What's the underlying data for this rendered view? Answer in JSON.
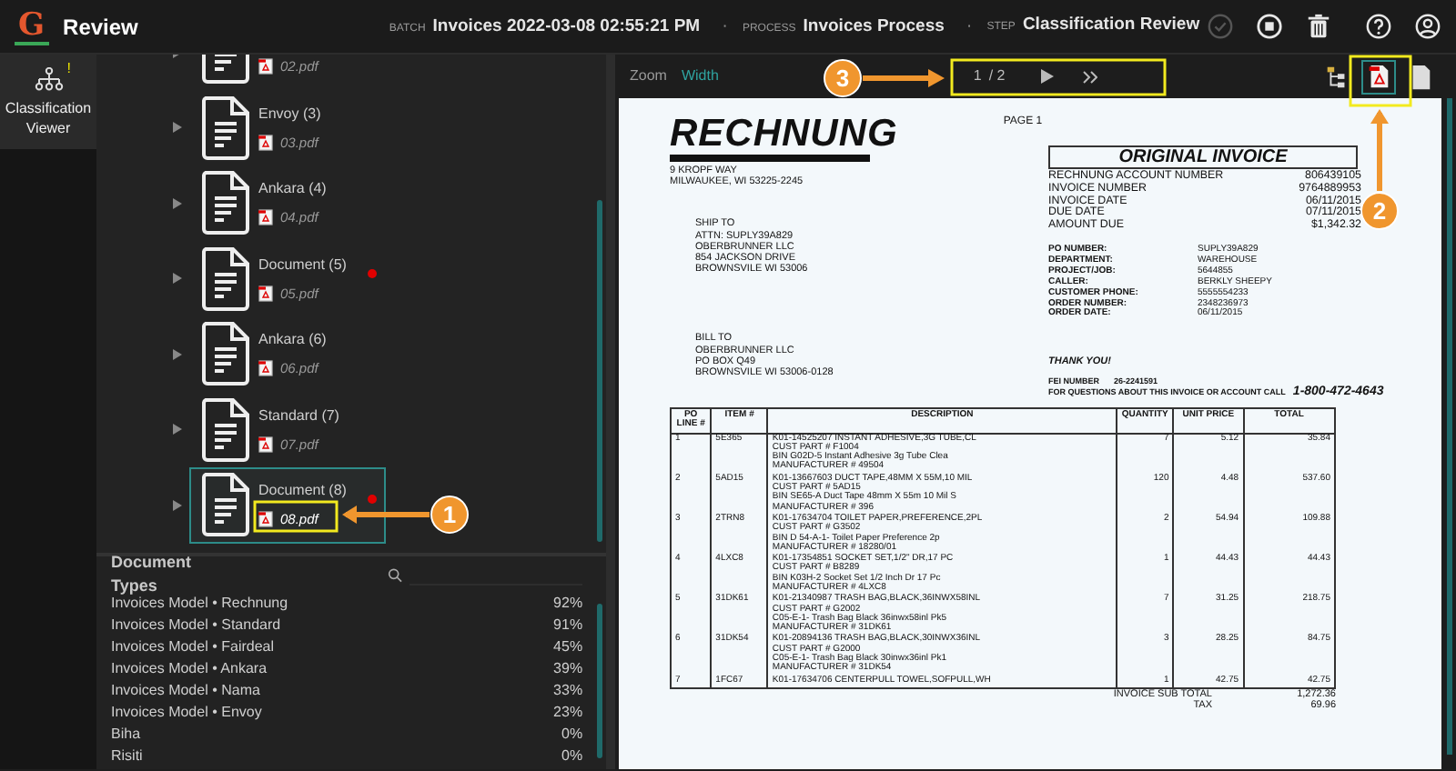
{
  "app": {
    "logo": "G",
    "title": "Review",
    "batch_label": "BATCH",
    "batch": "Invoices 2022-03-08 02:55:21 PM",
    "process_label": "PROCESS",
    "process": "Invoices Process",
    "step_label": "STEP",
    "step": "Classification Review",
    "separators": [
      "·",
      "·"
    ],
    "actions": [
      {
        "kind": "confirm",
        "disabled": true
      },
      {
        "kind": "stop",
        "disabled": false
      },
      {
        "kind": "delete",
        "disabled": false
      },
      {
        "kind": "help",
        "disabled": false
      },
      {
        "kind": "user",
        "disabled": false
      }
    ]
  },
  "rail": [
    {
      "label": "Classification Viewer",
      "badge": "!",
      "selected": true
    }
  ],
  "documents": [
    {
      "file": "02.pdf",
      "flagged": false,
      "selected": false
    },
    {
      "name": "Envoy (3)",
      "file": "03.pdf",
      "flagged": false,
      "selected": false
    },
    {
      "name": "Ankara (4)",
      "file": "04.pdf",
      "flagged": false,
      "selected": false
    },
    {
      "name": "Document (5)",
      "file": "05.pdf",
      "flagged": true,
      "selected": false
    },
    {
      "name": "Ankara (6)",
      "file": "06.pdf",
      "flagged": false,
      "selected": false
    },
    {
      "name": "Standard (7)",
      "file": "07.pdf",
      "flagged": false,
      "selected": false
    },
    {
      "name": "Document (8)",
      "file": "08.pdf",
      "flagged": true,
      "selected": true
    }
  ],
  "document_types": {
    "title": "Document Types",
    "rows": [
      {
        "name": "Invoices Model • Rechnung",
        "score": "92%"
      },
      {
        "name": "Invoices Model • Standard",
        "score": "91%"
      },
      {
        "name": "Invoices Model • Fairdeal",
        "score": "45%"
      },
      {
        "name": "Invoices Model • Ankara",
        "score": "39%"
      },
      {
        "name": "Invoices Model • Nama",
        "score": "33%"
      },
      {
        "name": "Invoices Model • Envoy",
        "score": "23%"
      },
      {
        "name": "Biha",
        "score": "0%"
      },
      {
        "name": "Risiti",
        "score": "0%"
      }
    ]
  },
  "viewer": {
    "zoom_label": "Zoom",
    "zoom_value": "Width",
    "page": "1",
    "page_total": "/ 2",
    "tools": [
      {
        "kind": "tree",
        "selected": false
      },
      {
        "kind": "pdf",
        "selected": true
      },
      {
        "kind": "page",
        "selected": false
      }
    ]
  },
  "invoice": {
    "logo": "RECHNUNG",
    "page": "PAGE 1",
    "address": [
      "9 KROPF WAY",
      "MILWAUKEE, WI 53225-2245"
    ],
    "ship_to": [
      "SHIP TO",
      "ATTN: SUPLY39A829",
      "OBERBRUNNER LLC",
      "854 JACKSON DRIVE",
      "BROWNSVILE WI  53006"
    ],
    "bill_to": [
      "BILL TO",
      "OBERBRUNNER LLC",
      "PO BOX Q49",
      "BROWNSVILE WI  53006-0128"
    ],
    "heading": "ORIGINAL INVOICE",
    "summary": [
      {
        "label": "RECHNUNG ACCOUNT NUMBER",
        "value": "806439105"
      },
      {
        "label": "INVOICE NUMBER",
        "value": "9764889953"
      },
      {
        "label": "INVOICE DATE",
        "value": "06/11/2015"
      },
      {
        "label": "DUE DATE",
        "value": "07/11/2015"
      },
      {
        "label": "AMOUNT DUE",
        "value": "$1,342.32"
      }
    ],
    "order_info": [
      {
        "label": "PO NUMBER:",
        "value": "SUPLY39A829"
      },
      {
        "label": "DEPARTMENT:",
        "value": "WAREHOUSE"
      },
      {
        "label": "PROJECT/JOB:",
        "value": "5644855"
      },
      {
        "label": "CALLER:",
        "value": "BERKLY SHEEPY"
      },
      {
        "label": "CUSTOMER PHONE:",
        "value": "5555554233"
      },
      {
        "label": "ORDER NUMBER:",
        "value": "2348236973"
      },
      {
        "label": "ORDER DATE:",
        "value": "06/11/2015"
      }
    ],
    "thanks": "THANK YOU!",
    "fei_label": "FEI NUMBER",
    "fei": "26-2241591",
    "questions": "FOR QUESTIONS ABOUT THIS INVOICE OR ACCOUNT CALL",
    "phone": "1-800-472-4643",
    "columns": [
      "PO LINE #",
      "ITEM #",
      "DESCRIPTION",
      "QUANTITY",
      "UNIT PRICE",
      "TOTAL"
    ],
    "rows": [
      {
        "po": "1",
        "item": "5E365",
        "description": [
          "K01-14525207 INSTANT ADHESIVE,3G TUBE,CL",
          "CUST PART # F1004",
          "BIN G02D-5 Instant Adhesive 3g Tube Clea",
          "MANUFACTURER # 49504"
        ],
        "quantity": "7",
        "unit_price": "5.12",
        "total": "35.84"
      },
      {
        "po": "2",
        "item": "5AD15",
        "description": [
          "K01-13667603 DUCT TAPE,48MM X 55M,10 MIL",
          "CUST PART # 5AD15",
          "BIN SE65-A Duct Tape 48mm X 55m 10 Mil S",
          "MANUFACTURER # 396"
        ],
        "quantity": "120",
        "unit_price": "4.48",
        "total": "537.60"
      },
      {
        "po": "3",
        "item": "2TRN8",
        "description": [
          "K01-17634704 TOILET PAPER,PREFERENCE,2PL",
          "CUST PART # G3502",
          "BIN D 54-A-1- Toilet Paper Preference 2p",
          "MANUFACTURER # 18280/01"
        ],
        "quantity": "2",
        "unit_price": "54.94",
        "total": "109.88"
      },
      {
        "po": "4",
        "item": "4LXC8",
        "description": [
          "K01-17354851 SOCKET SET,1/2\" DR,17 PC",
          "CUST PART # B8289",
          "BIN K03H-2 Socket Set 1/2 Inch  Dr 17 Pc",
          "MANUFACTURER # 4LXC8"
        ],
        "quantity": "1",
        "unit_price": "44.43",
        "total": "44.43"
      },
      {
        "po": "5",
        "item": "31DK61",
        "description": [
          "K01-21340987 TRASH BAG,BLACK,36INWX58INL",
          "CUST PART # G2002",
          "C05-E-1- Trash Bag Black 36inwx58inl Pk5",
          "MANUFACTURER # 31DK61"
        ],
        "quantity": "7",
        "unit_price": "31.25",
        "total": "218.75"
      },
      {
        "po": "6",
        "item": "31DK54",
        "description": [
          "K01-20894136 TRASH BAG,BLACK,30INWX36INL",
          "CUST PART # G2000",
          "C05-E-1- Trash Bag Black 30inwx36inl Pk1",
          "MANUFACTURER # 31DK54"
        ],
        "quantity": "3",
        "unit_price": "28.25",
        "total": "84.75"
      },
      {
        "po": "7",
        "item": "1FC67",
        "description": [
          "K01-17634706 CENTERPULL TOWEL,SOFPULL,WH"
        ],
        "quantity": "1",
        "unit_price": "42.75",
        "total": "42.75"
      }
    ],
    "totals": [
      {
        "label": "INVOICE SUB TOTAL",
        "value": "1,272.36"
      },
      {
        "label": "TAX",
        "value": "69.96"
      }
    ]
  },
  "callouts": [
    {
      "number": "1"
    },
    {
      "number": "2"
    },
    {
      "number": "3"
    }
  ]
}
